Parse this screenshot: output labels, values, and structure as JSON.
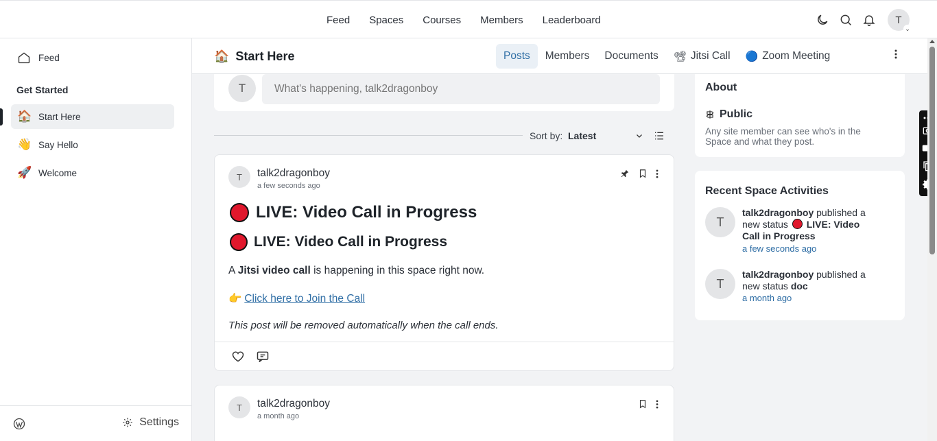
{
  "topnav": {
    "items": [
      "Feed",
      "Spaces",
      "Courses",
      "Members",
      "Leaderboard"
    ],
    "avatar_initial": "T"
  },
  "sidebar": {
    "feed_label": "Feed",
    "heading": "Get Started",
    "items": [
      {
        "label": "Start Here",
        "icon": "house-emoji"
      },
      {
        "label": "Say Hello",
        "icon": "waving-hand-emoji"
      },
      {
        "label": "Welcome",
        "icon": "rocket-emoji"
      }
    ],
    "settings_label": "Settings"
  },
  "space": {
    "title": "Start Here",
    "tabs": [
      "Posts",
      "Members",
      "Documents",
      "Jitsi Call",
      "Zoom Meeting"
    ],
    "active_tab": "Posts"
  },
  "composer": {
    "avatar_initial": "T",
    "placeholder": "What's happening, talk2dragonboy"
  },
  "sort": {
    "label": "Sort by:",
    "value": "Latest"
  },
  "posts": [
    {
      "avatar_initial": "T",
      "author": "talk2dragonboy",
      "time": "a few seconds ago",
      "heading1": "LIVE: Video Call in Progress",
      "heading2": "LIVE: Video Call in Progress",
      "text_a": "A ",
      "text_bold": "Jitsi video call",
      "text_b": " is happening in this space right now.",
      "link": "Click here to Join the Call",
      "note": "This post will be removed automatically when the call ends."
    },
    {
      "avatar_initial": "T",
      "author": "talk2dragonboy",
      "time": "a month ago"
    }
  ],
  "about": {
    "title": "About",
    "privacy": "Public",
    "description": "Any site member can see who's in the Space and what they post."
  },
  "recent": {
    "title": "Recent Space Activities",
    "items": [
      {
        "avatar_initial": "T",
        "author": "talk2dragonboy",
        "action": "published a new status",
        "subject": "LIVE: Video Call in Progress",
        "when": "a few seconds ago"
      },
      {
        "avatar_initial": "T",
        "author": "talk2dragonboy",
        "action": "published a new status",
        "subject": "doc",
        "when": "a month ago"
      }
    ]
  },
  "colors": {
    "accent": "#2f6ea5",
    "live_red": "#e0172c",
    "active_tab_bg": "#eaf0f6"
  }
}
